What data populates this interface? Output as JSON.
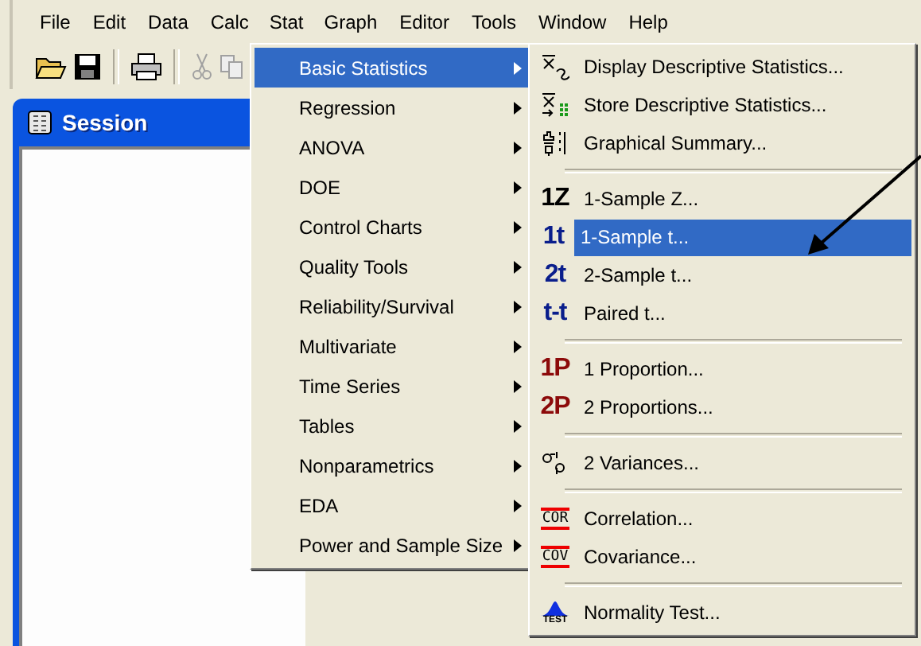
{
  "menubar": [
    {
      "label": "File",
      "selected": false
    },
    {
      "label": "Edit",
      "selected": false
    },
    {
      "label": "Data",
      "selected": false
    },
    {
      "label": "Calc",
      "selected": false
    },
    {
      "label": "Stat",
      "selected": true
    },
    {
      "label": "Graph",
      "selected": false
    },
    {
      "label": "Editor",
      "selected": false
    },
    {
      "label": "Tools",
      "selected": false
    },
    {
      "label": "Window",
      "selected": false
    },
    {
      "label": "Help",
      "selected": false
    }
  ],
  "toolbar": [
    {
      "kind": "open",
      "disabled": false
    },
    {
      "kind": "save",
      "disabled": false
    },
    {
      "kind": "sep"
    },
    {
      "kind": "print",
      "disabled": false
    },
    {
      "kind": "sep"
    },
    {
      "kind": "cut",
      "disabled": true
    },
    {
      "kind": "copy",
      "disabled": true
    }
  ],
  "session_window": {
    "title": "Session"
  },
  "stat_menu": [
    {
      "label": "Basic Statistics",
      "selected": true
    },
    {
      "label": "Regression",
      "selected": false
    },
    {
      "label": "ANOVA",
      "selected": false
    },
    {
      "label": "DOE",
      "selected": false
    },
    {
      "label": "Control Charts",
      "selected": false
    },
    {
      "label": "Quality Tools",
      "selected": false
    },
    {
      "label": "Reliability/Survival",
      "selected": false
    },
    {
      "label": "Multivariate",
      "selected": false
    },
    {
      "label": "Time Series",
      "selected": false
    },
    {
      "label": "Tables",
      "selected": false
    },
    {
      "label": "Nonparametrics",
      "selected": false
    },
    {
      "label": "EDA",
      "selected": false
    },
    {
      "label": "Power and Sample Size",
      "selected": false
    }
  ],
  "basic_statistics_menu": [
    {
      "kind": "display",
      "label": "Display Descriptive Statistics...",
      "selected": false
    },
    {
      "kind": "store",
      "label": "Store Descriptive Statistics...",
      "selected": false
    },
    {
      "kind": "summary",
      "label": "Graphical Summary...",
      "selected": false
    },
    {
      "kind": "separator"
    },
    {
      "kind": "glyph",
      "badge": "1Z",
      "color": "#000000",
      "label": "1-Sample Z...",
      "selected": false
    },
    {
      "kind": "glyph",
      "badge": "1t",
      "color": "#0a1e8c",
      "label": "1-Sample t...",
      "selected": true
    },
    {
      "kind": "glyph",
      "badge": "2t",
      "color": "#0a1e8c",
      "label": "2-Sample t...",
      "selected": false
    },
    {
      "kind": "glyph",
      "badge": "t-t",
      "color": "#0a1e8c",
      "label": "Paired t...",
      "selected": false
    },
    {
      "kind": "separator"
    },
    {
      "kind": "glyph",
      "badge": "1P",
      "color": "#8c0a0a",
      "label": "1 Proportion...",
      "selected": false
    },
    {
      "kind": "glyph",
      "badge": "2P",
      "color": "#8c0a0a",
      "label": "2 Proportions...",
      "selected": false
    },
    {
      "kind": "separator"
    },
    {
      "kind": "variances",
      "label": "2 Variances...",
      "selected": false
    },
    {
      "kind": "separator"
    },
    {
      "kind": "boxed",
      "badge": "COR",
      "label": "Correlation...",
      "selected": false
    },
    {
      "kind": "boxed",
      "badge": "COV",
      "label": "Covariance...",
      "selected": false
    },
    {
      "kind": "separator"
    },
    {
      "kind": "normal",
      "badge": "TEST",
      "label": "Normality Test...",
      "selected": false
    }
  ]
}
